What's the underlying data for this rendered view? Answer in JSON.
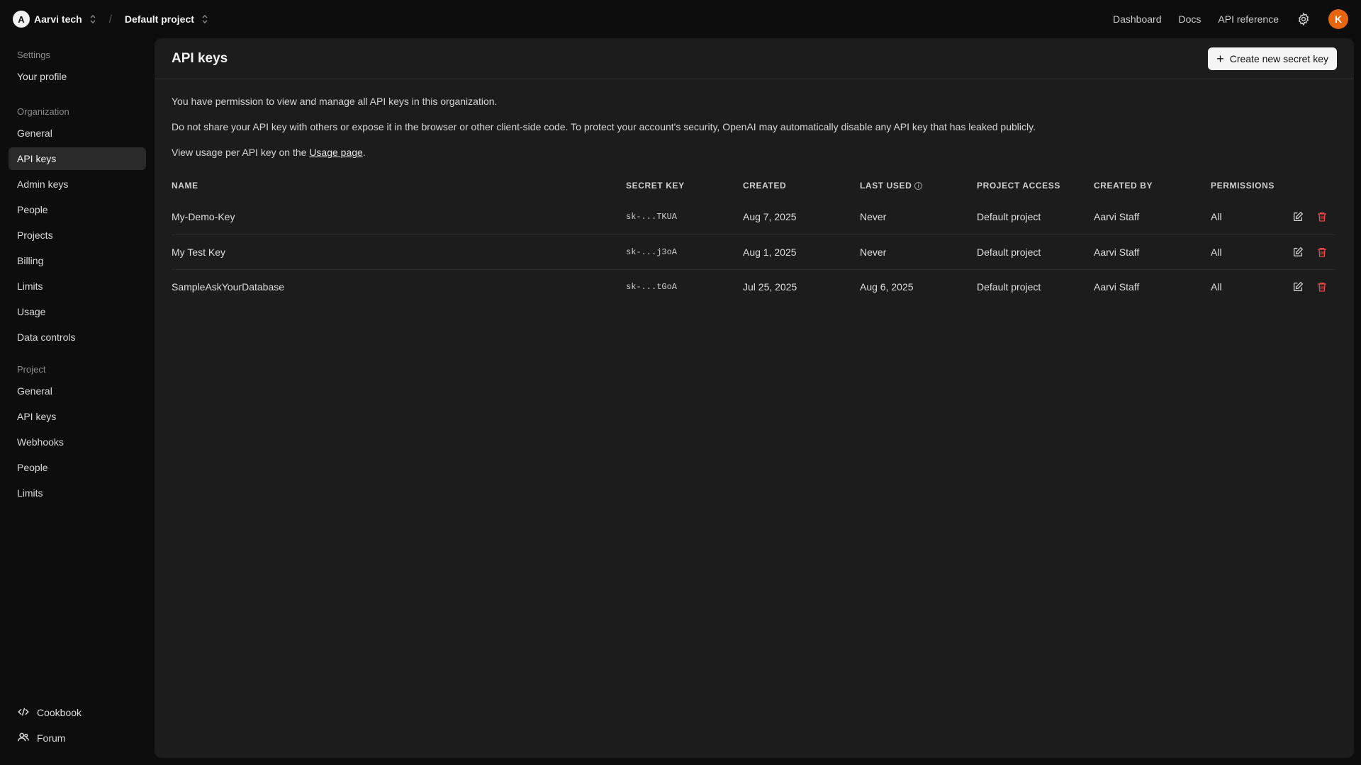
{
  "org": {
    "avatar_letter": "A",
    "name": "Aarvi tech"
  },
  "project": {
    "name": "Default project"
  },
  "breadcrumb_separator": "/",
  "topnav": {
    "dashboard": "Dashboard",
    "docs": "Docs",
    "api_reference": "API reference",
    "user_initial": "K"
  },
  "colors": {
    "accent_user": "#e8650f",
    "danger": "#e5484d"
  },
  "sidebar": {
    "settings_heading": "Settings",
    "your_profile": "Your profile",
    "organization_heading": "Organization",
    "org_items": [
      "General",
      "API keys",
      "Admin keys",
      "People",
      "Projects",
      "Billing",
      "Limits",
      "Usage",
      "Data controls"
    ],
    "project_heading": "Project",
    "project_items": [
      "General",
      "API keys",
      "Webhooks",
      "People",
      "Limits"
    ],
    "cookbook": "Cookbook",
    "forum": "Forum"
  },
  "main": {
    "title": "API keys",
    "create_button": "Create new secret key",
    "note1": "You have permission to view and manage all API keys in this organization.",
    "note2": "Do not share your API key with others or expose it in the browser or other client-side code. To protect your account's security, OpenAI may automatically disable any API key that has leaked publicly.",
    "note3_prefix": "View usage per API key on the ",
    "note3_link": "Usage page",
    "note3_suffix": "."
  },
  "table": {
    "headers": {
      "name": "NAME",
      "secret_key": "SECRET KEY",
      "created": "CREATED",
      "last_used": "LAST USED",
      "project_access": "PROJECT ACCESS",
      "created_by": "CREATED BY",
      "permissions": "PERMISSIONS"
    },
    "rows": [
      {
        "name": "My-Demo-Key",
        "secret_key": "sk-...TKUA",
        "created": "Aug 7, 2025",
        "last_used": "Never",
        "project_access": "Default project",
        "created_by": "Aarvi Staff",
        "permissions": "All"
      },
      {
        "name": "My Test Key",
        "secret_key": "sk-...j3oA",
        "created": "Aug 1, 2025",
        "last_used": "Never",
        "project_access": "Default project",
        "created_by": "Aarvi Staff",
        "permissions": "All"
      },
      {
        "name": "SampleAskYourDatabase",
        "secret_key": "sk-...tGoA",
        "created": "Jul 25, 2025",
        "last_used": "Aug 6, 2025",
        "project_access": "Default project",
        "created_by": "Aarvi Staff",
        "permissions": "All"
      }
    ]
  }
}
